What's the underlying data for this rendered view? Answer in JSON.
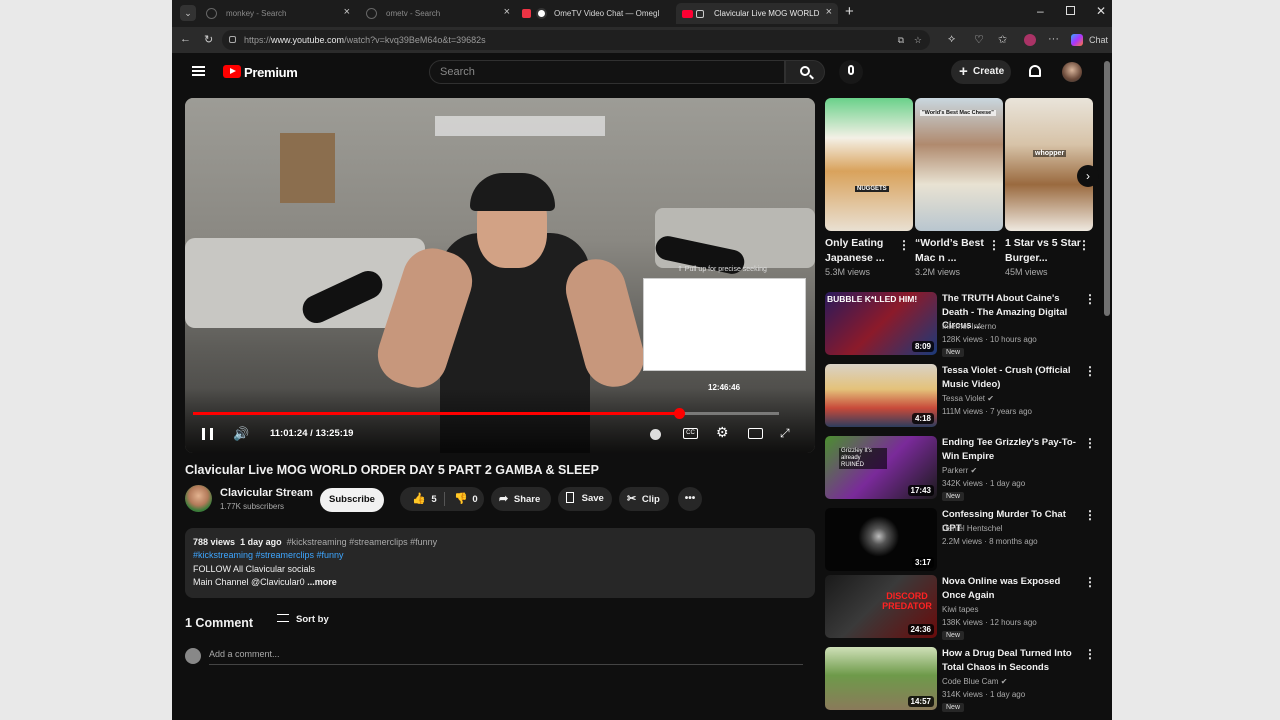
{
  "browser": {
    "tabs": [
      {
        "title": "monkey - Search"
      },
      {
        "title": "ometv - Search"
      },
      {
        "title": "OmeTV Video Chat — Omegl"
      },
      {
        "title": "Clavicular Live MOG WORLD"
      }
    ],
    "url_prefix": "https://",
    "url_host": "www.youtube.com",
    "url_path": "/watch?v=kvq39BeM64o&t=39682s",
    "copilot_label": "Chat"
  },
  "youtube": {
    "brand": "Premium",
    "search_placeholder": "Search",
    "create_label": "Create"
  },
  "player": {
    "seek_hint": "⇑ Pull up for precise seeking",
    "hover_time": "12:46:46",
    "current_time": "11:01:24",
    "total_time": "13:25:19",
    "progress_fraction": 0.83
  },
  "video": {
    "title": "Clavicular Live MOG WORLD ORDER DAY 5 PART 2 GAMBA & SLEEP",
    "channel": "Clavicular Stream",
    "subscribers": "1.77K subscribers",
    "subscribe_label": "Subscribe",
    "likes": "5",
    "dislikes": "0",
    "share_label": "Share",
    "save_label": "Save",
    "clip_label": "Clip"
  },
  "description": {
    "views": "788 views",
    "age": "1 day ago",
    "tags_line1": "#kickstreaming #streamerclips #funny",
    "tags_line2": "#kickstreaming #streamerclips #funny",
    "line3": "FOLLOW All Clavicular socials",
    "line4": "Main Channel @Clavicular0",
    "more": "...more"
  },
  "comments": {
    "count_label": "1 Comment",
    "sort_label": "Sort by",
    "add_placeholder": "Add a comment..."
  },
  "shorts": [
    {
      "title": "Only Eating Japanese ...",
      "views": "5.3M views",
      "overlay": "NUGGETS"
    },
    {
      "title": "“World’s Best Mac n ...",
      "views": "3.2M views",
      "overlay": "\"World's Best Mac Cheese\""
    },
    {
      "title": "1 Star vs 5 Star Burger...",
      "views": "45M views",
      "overlay": "whopper"
    }
  ],
  "recommendations": [
    {
      "title": "The TRUTH About Caine's Death - The Amazing Digital Circus ...",
      "channel": "Internet Inferno",
      "views": "128K views · 10 hours ago",
      "duration": "8:09",
      "badge": "New",
      "thumb_text": "BUBBLE K*LLED HIM!",
      "verified": false
    },
    {
      "title": "Tessa Violet - Crush (Official Music Video)",
      "channel": "Tessa Violet",
      "views": "111M views · 7 years ago",
      "duration": "4:18",
      "badge": "",
      "thumb_text": "",
      "verified": true
    },
    {
      "title": "Ending Tee Grizzley's Pay-To-Win Empire",
      "channel": "Parkerr",
      "views": "342K views · 1 day ago",
      "duration": "17:43",
      "badge": "New",
      "thumb_text": "Grizzley It's already RUINED",
      "verified": true
    },
    {
      "title": "Confessing Murder To Chat GPT",
      "channel": "Daniel Hentschel",
      "views": "2.2M views · 8 months ago",
      "duration": "3:17",
      "badge": "",
      "thumb_text": "",
      "verified": false
    },
    {
      "title": "Nova Online was Exposed Once Again",
      "channel": "Kiwi tapes",
      "views": "138K views · 12 hours ago",
      "duration": "24:36",
      "badge": "New",
      "thumb_text": "DISCORD PREDATOR",
      "verified": false
    },
    {
      "title": "How a Drug Deal Turned Into Total Chaos in Seconds",
      "channel": "Code Blue Cam",
      "views": "314K views · 1 day ago",
      "duration": "14:57",
      "badge": "New",
      "thumb_text": "",
      "verified": true
    }
  ],
  "colors": {
    "brand_red": "#ff0000",
    "link_blue": "#3ea6ff",
    "bg": "#0f0f0f"
  }
}
